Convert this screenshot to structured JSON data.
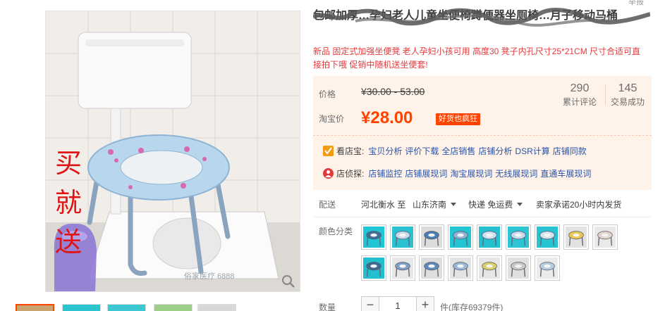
{
  "gallery": {
    "promo_text": "买就送",
    "watermark": "俗家医疗 6888"
  },
  "header": {
    "top_corner": "举报",
    "title": "包邮加厚…孕妇老人儿童坐便椅蹲便器坐厕椅…月子移动马桶",
    "subtitle_red": "新品 固定式加强坐便凳 老人孕妇小孩可用 高度30 凳子内孔尺寸25*21CM 尺寸合适可直接拍下哦 促销中随机送坐便套!"
  },
  "price": {
    "label_price": "价格",
    "original": "¥30.00 - 53.00",
    "label_taobao": "淘宝价",
    "current": "¥28.00",
    "badge": "好货也疯狂",
    "stats": [
      {
        "num": "290",
        "label": "累计评论"
      },
      {
        "num": "145",
        "label": "交易成功"
      }
    ]
  },
  "tools": {
    "shop_watch": {
      "lead": "看店宝:",
      "links": [
        "宝贝分析",
        "评价下载",
        "全店销售",
        "店铺分析",
        "DSR计算",
        "店铺同款"
      ]
    },
    "shop_detect": {
      "lead": "店侦探:",
      "links": [
        "店铺监控",
        "店铺展现词",
        "淘宝展现词",
        "无线展现词",
        "直通车展现词"
      ]
    }
  },
  "shipping": {
    "label": "配送",
    "from": "河北衡水 至",
    "to": "山东济南",
    "method": "快递 免运费",
    "promise": "卖家承诺20小时内发货"
  },
  "colors": {
    "label": "颜色分类",
    "accent": "#f40",
    "swatch_count": 16
  },
  "quantity": {
    "label": "数量",
    "minus": "−",
    "value": "1",
    "plus": "+",
    "stock": "件(库存69379件)"
  }
}
